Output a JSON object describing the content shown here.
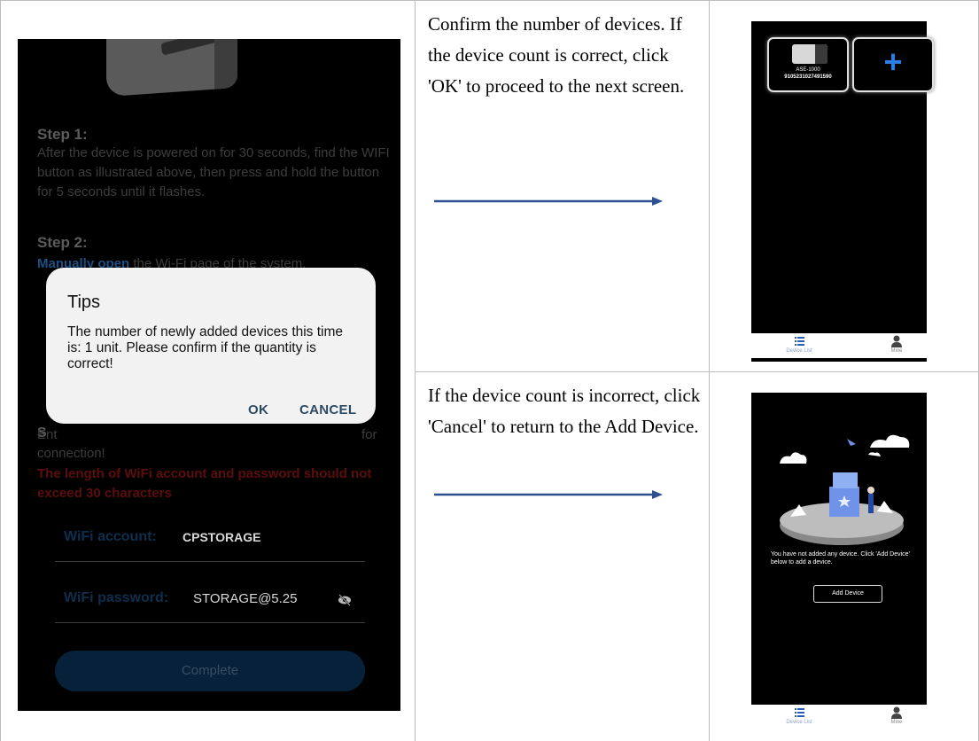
{
  "left_screenshot": {
    "step1_title": "Step 1:",
    "step1_text": "After the device is powered on for 30 seconds, find the WIFI button as illustrated above, then press and hold the button for 5 seconds until it flashes.",
    "step2_title": "Step 2:",
    "step2_link": "Manually open",
    "step2_text": " the Wi-Fi page of the system.",
    "step3_lead": "S",
    "step3_tail": "for",
    "partial_line": "Ent",
    "connection_text": "connection!",
    "warning_text": "The length of WiFi account and password should not exceed 30 characters",
    "wifi_account_label": "WiFi account:",
    "wifi_account_value": "CPSTORAGE",
    "wifi_password_label": "WiFi password:",
    "wifi_password_value": "STORAGE@5.25",
    "complete_button": "Complete",
    "dialog": {
      "title": "Tips",
      "message": "The number of newly added devices this time is: 1 unit. Please confirm if the quantity is correct!",
      "ok": "OK",
      "cancel": "CANCEL"
    }
  },
  "instructions": {
    "confirm": "Confirm the number of devices. If the device count is correct, click 'OK' to proceed to the next screen.",
    "cancel": "If the device count is incorrect, click 'Cancel' to return to the Add Device."
  },
  "device_list_screenshot": {
    "device_model": "ASE-1000",
    "device_serial": "9105231027491590",
    "tab_device_list": "Device List",
    "tab_mine": "Mine"
  },
  "empty_list_screenshot": {
    "message": "You have not added any device. Click 'Add Device' below to add a device.",
    "add_button": "Add Device",
    "tab_device_list": "Device List",
    "tab_mine": "Mine"
  },
  "colors": {
    "arrow": "#2e4f8f",
    "plus_icon": "#2a7ee6",
    "warning": "#5d0d0d"
  }
}
